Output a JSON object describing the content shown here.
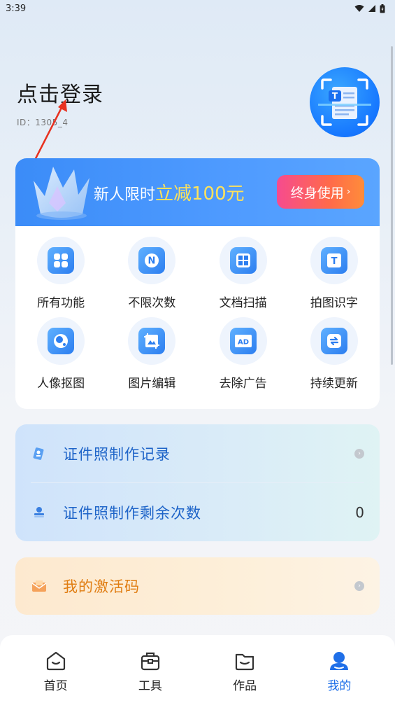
{
  "status": {
    "time": "3:39",
    "icons": [
      "wifi-icon",
      "signal-icon",
      "battery-icon"
    ]
  },
  "profile": {
    "login_prompt": "点击登录",
    "user_id": "ID：1305_4"
  },
  "vip": {
    "promo_prefix": "新人限时",
    "promo_highlight": "立减100元",
    "button_label": "终身使用",
    "button_chevron": "›"
  },
  "features": [
    {
      "label": "所有功能",
      "icon": "grid-icon"
    },
    {
      "label": "不限次数",
      "icon": "n-badge-icon"
    },
    {
      "label": "文档扫描",
      "icon": "doc-scan-icon"
    },
    {
      "label": "拍图识字",
      "icon": "text-recognition-icon"
    },
    {
      "label": "人像抠图",
      "icon": "portrait-cutout-icon"
    },
    {
      "label": "图片编辑",
      "icon": "image-edit-icon"
    },
    {
      "label": "去除广告",
      "icon": "ad-remove-icon"
    },
    {
      "label": "持续更新",
      "icon": "refresh-icon"
    }
  ],
  "id_photo": {
    "records_label": "证件照制作记录",
    "remaining_label": "证件照制作剩余次数",
    "remaining_count": "0"
  },
  "activation": {
    "label": "我的激活码"
  },
  "nav": [
    {
      "label": "首页",
      "icon": "home-icon"
    },
    {
      "label": "工具",
      "icon": "toolbox-icon"
    },
    {
      "label": "作品",
      "icon": "folder-icon"
    },
    {
      "label": "我的",
      "icon": "profile-icon"
    }
  ],
  "colors": {
    "accent": "#1f6fe8",
    "vip_banner": "#4f9bff",
    "highlight_yellow": "#ffe25a",
    "activation_orange": "#e07d12"
  }
}
